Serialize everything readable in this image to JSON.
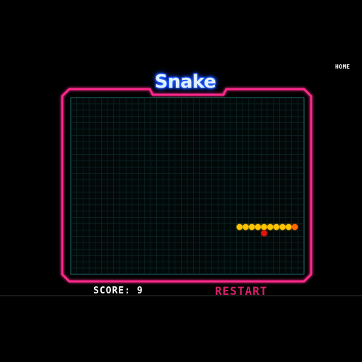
{
  "nav": {
    "home_label": "HOME"
  },
  "game": {
    "title": "Snake",
    "score_label": "SCORE:",
    "score_value": "9",
    "restart_label": "RESTART"
  },
  "grid": {
    "columns": 38,
    "rows": 28
  },
  "snake": {
    "head": [
      36,
      20
    ],
    "body": [
      [
        35,
        20
      ],
      [
        34,
        20
      ],
      [
        33,
        20
      ],
      [
        32,
        20
      ],
      [
        31,
        20
      ],
      [
        30,
        20
      ],
      [
        29,
        20
      ],
      [
        28,
        20
      ],
      [
        27,
        20
      ]
    ]
  },
  "food": [
    31,
    21
  ],
  "colors": {
    "background": "#000000",
    "frame": "#ff2a8a",
    "board_border": "#1f6f73",
    "grid_line": "#0f2d2e",
    "snake_body": "#ffc400",
    "snake_head": "#ff6a00",
    "food": "#e0140f",
    "restart": "#d61f69",
    "title_glow": "#2a6bff"
  }
}
